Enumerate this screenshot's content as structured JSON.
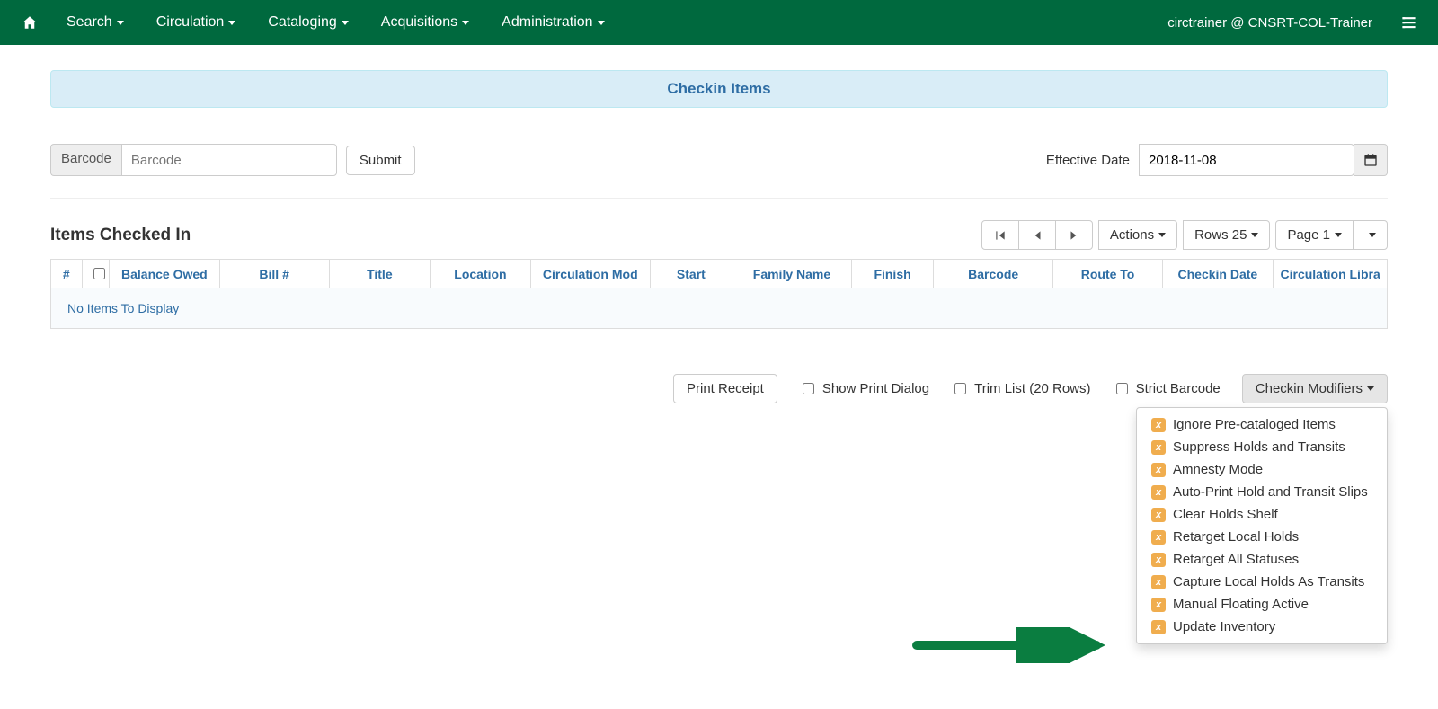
{
  "nav": {
    "items": [
      "Search",
      "Circulation",
      "Cataloging",
      "Acquisitions",
      "Administration"
    ],
    "user": "circtrainer @ CNSRT-COL-Trainer"
  },
  "header": {
    "title": "Checkin Items"
  },
  "barcode": {
    "addon": "Barcode",
    "placeholder": "Barcode",
    "submit": "Submit"
  },
  "effective_date": {
    "label": "Effective Date",
    "value": "2018-11-08"
  },
  "list": {
    "title": "Items Checked In",
    "actions_label": "Actions",
    "rows_label": "Rows 25",
    "page_label": "Page 1",
    "columns": [
      "#",
      "",
      "Balance Owed",
      "Bill #",
      "Title",
      "Location",
      "Circulation Mod",
      "Start",
      "Family Name",
      "Finish",
      "Barcode",
      "Route To",
      "Checkin Date",
      "Circulation Libra"
    ],
    "empty": "No Items To Display"
  },
  "footer": {
    "print_receipt": "Print Receipt",
    "show_print_dialog": "Show Print Dialog",
    "trim_list": "Trim List (20 Rows)",
    "strict_barcode": "Strict Barcode",
    "modifiers_button": "Checkin Modifiers",
    "modifiers": [
      "Ignore Pre-cataloged Items",
      "Suppress Holds and Transits",
      "Amnesty Mode",
      "Auto-Print Hold and Transit Slips",
      "Clear Holds Shelf",
      "Retarget Local Holds",
      "Retarget All Statuses",
      "Capture Local Holds As Transits",
      "Manual Floating Active",
      "Update Inventory"
    ]
  }
}
